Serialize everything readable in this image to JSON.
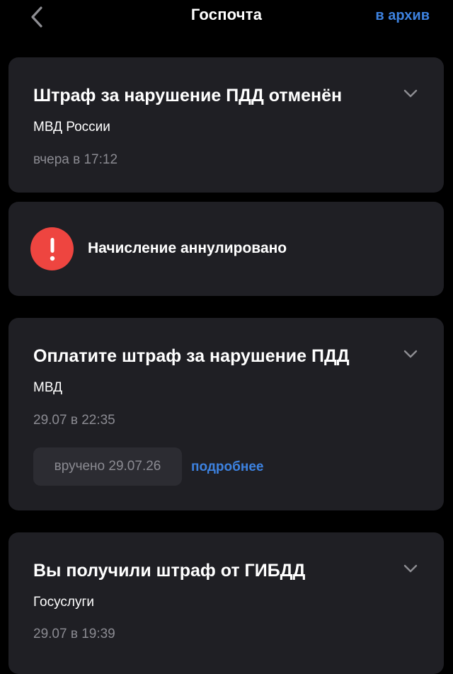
{
  "header": {
    "title": "Госпочта",
    "archive_label": "в архив",
    "back_icon": "chevron-left-icon"
  },
  "colors": {
    "background": "#000000",
    "card": "#1f1f24",
    "accent": "#3d82e0",
    "alert": "#ee4540",
    "muted_text": "#8b8b92"
  },
  "messages": [
    {
      "title": "Штраф за нарушение ПДД отменён",
      "sender": "МВД России",
      "time": "вчера в 17:12",
      "icon": "chevron-down-icon"
    },
    {
      "title": "Оплатите штраф за нарушение ПДД",
      "sender": "МВД",
      "time": "29.07 в 22:35",
      "delivered": "вручено 29.07.26",
      "details_label": "подробнее",
      "icon": "chevron-down-icon"
    },
    {
      "title": "Вы получили штраф от ГИБДД",
      "sender": "Госуслуги",
      "time": "29.07 в 19:39",
      "icon": "chevron-down-icon"
    }
  ],
  "alert": {
    "text": "Начисление аннулировано",
    "icon": "exclamation-icon"
  }
}
